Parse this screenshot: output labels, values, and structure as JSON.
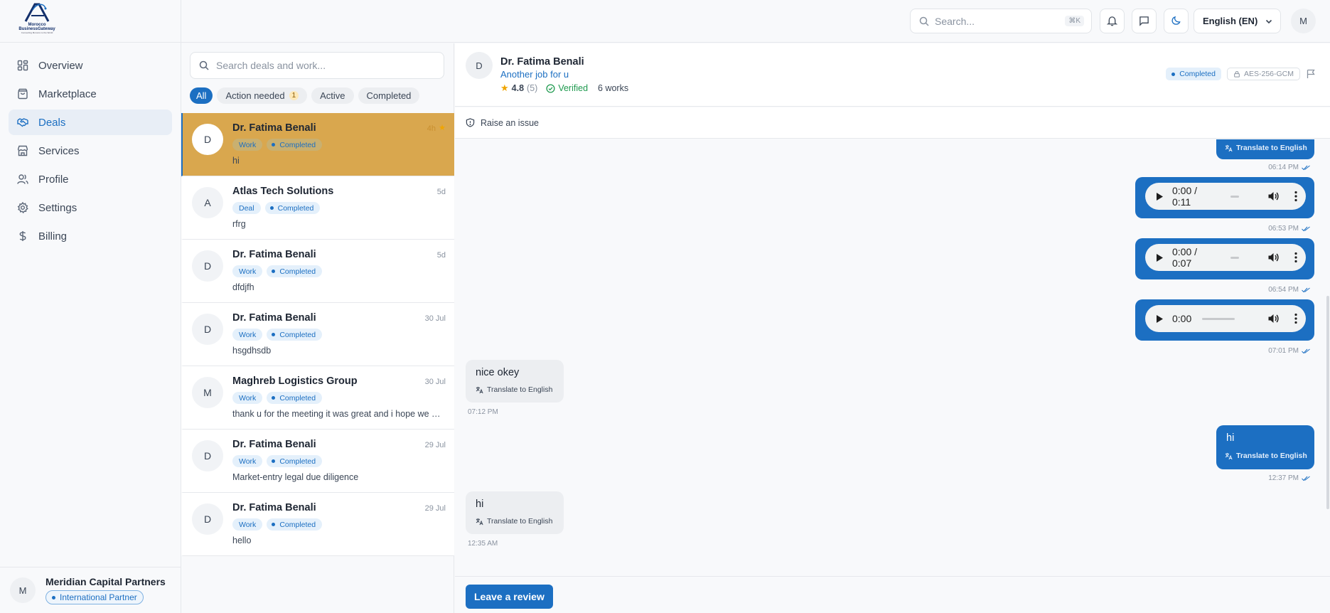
{
  "brand": {
    "line1": "Morocco",
    "line2": "BusinessGateway",
    "tagline": "Connecting Morocco to the World"
  },
  "sidebar": {
    "items": [
      {
        "label": "Overview",
        "icon": "grid-icon"
      },
      {
        "label": "Marketplace",
        "icon": "bag-icon"
      },
      {
        "label": "Deals",
        "icon": "handshake-icon",
        "active": true
      },
      {
        "label": "Services",
        "icon": "store-icon"
      },
      {
        "label": "Profile",
        "icon": "users-icon"
      },
      {
        "label": "Settings",
        "icon": "gear-icon"
      },
      {
        "label": "Billing",
        "icon": "dollar-icon"
      }
    ],
    "user": {
      "initial": "M",
      "name": "Meridian Capital Partners",
      "badge": "International Partner"
    }
  },
  "topbar": {
    "search_placeholder": "Search...",
    "shortcut": "⌘K",
    "language": "English (EN)",
    "avatar_initial": "M"
  },
  "deals": {
    "search_placeholder": "Search deals and work...",
    "filters": [
      {
        "label": "All",
        "active": true
      },
      {
        "label": "Action needed",
        "count": "1"
      },
      {
        "label": "Active"
      },
      {
        "label": "Completed"
      }
    ],
    "list": [
      {
        "initial": "D",
        "name": "Dr. Fatima Benali",
        "time": "4h",
        "type": "Work",
        "status": "Completed",
        "message": "hi",
        "selected": true
      },
      {
        "initial": "A",
        "name": "Atlas Tech Solutions",
        "time": "5d",
        "type": "Deal",
        "status": "Completed",
        "message": "rfrg"
      },
      {
        "initial": "D",
        "name": "Dr. Fatima Benali",
        "time": "5d",
        "type": "Work",
        "status": "Completed",
        "message": "dfdjfh"
      },
      {
        "initial": "D",
        "name": "Dr. Fatima Benali",
        "time": "30 Jul",
        "type": "Work",
        "status": "Completed",
        "message": "hsgdhsdb"
      },
      {
        "initial": "M",
        "name": "Maghreb Logistics Group",
        "time": "30 Jul",
        "type": "Work",
        "status": "Completed",
        "message": "thank u for the meeting it was great and i hope we work together again soon"
      },
      {
        "initial": "D",
        "name": "Dr. Fatima Benali",
        "time": "29 Jul",
        "type": "Work",
        "status": "Completed",
        "message": "Market-entry legal due diligence"
      },
      {
        "initial": "D",
        "name": "Dr. Fatima Benali",
        "time": "29 Jul",
        "type": "Work",
        "status": "Completed",
        "message": "hello"
      }
    ]
  },
  "chat": {
    "initial": "D",
    "name": "Dr. Fatima Benali",
    "subtitle": "Another job for u",
    "rating": "4.8",
    "rating_count": "(5)",
    "verified": "Verified",
    "works": "6 works",
    "status_badge": "Completed",
    "encryption": "AES-256-GCM",
    "raise_issue": "Raise an issue",
    "translate_label": "Translate to English",
    "messages": [
      {
        "kind": "translate-only",
        "time": "06:14 PM"
      },
      {
        "kind": "audio",
        "audio_time": "0:00 / 0:11",
        "time": "06:53 PM"
      },
      {
        "kind": "audio",
        "audio_time": "0:00 / 0:07",
        "time": "06:54 PM"
      },
      {
        "kind": "audio",
        "audio_time": "0:00",
        "time": "07:01 PM"
      },
      {
        "kind": "in",
        "text": "nice okey",
        "time": "07:12 PM"
      },
      {
        "kind": "out",
        "text": "hi",
        "time": "12:37 PM"
      },
      {
        "kind": "in",
        "text": "hi",
        "time": "12:35 AM"
      }
    ],
    "review_button": "Leave a review"
  }
}
